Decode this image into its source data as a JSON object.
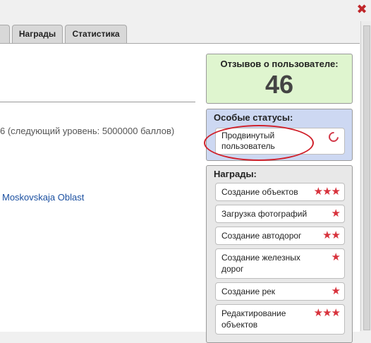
{
  "window": {
    "close_glyph": "✖"
  },
  "tabs": [
    {
      "label": ""
    },
    {
      "label": "Награды"
    },
    {
      "label": "Статистика"
    }
  ],
  "main": {
    "level_text": "6 (следующий уровень: 5000000 баллов)",
    "region_link": "Moskovskaja Oblast"
  },
  "reviews": {
    "title": "Отзывов о пользователе:",
    "count": "46"
  },
  "statuses": {
    "title": "Особые статусы:",
    "items": [
      {
        "label": "Продвинутый пользователь",
        "icon": "crescent-icon"
      }
    ]
  },
  "awards": {
    "title": "Награды:",
    "items": [
      {
        "label": "Создание объектов",
        "stars": 3
      },
      {
        "label": "Загрузка фотографий",
        "stars": 1
      },
      {
        "label": "Создание автодорог",
        "stars": 2
      },
      {
        "label": "Создание железных дорог",
        "stars": 1
      },
      {
        "label": "Создание рек",
        "stars": 1
      },
      {
        "label": "Редактирование объектов",
        "stars": 3
      }
    ]
  },
  "colors": {
    "reviews_bg": "#dff5cf",
    "statuses_bg": "#cdd8f2",
    "awards_bg": "#e8e8e8",
    "star": "#d8323c",
    "highlight_oval": "#d0202a",
    "link": "#1a4fa0"
  }
}
